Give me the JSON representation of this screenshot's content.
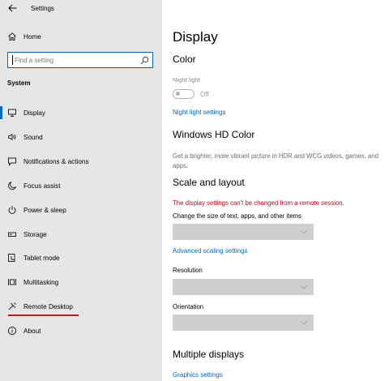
{
  "window": {
    "title": "Settings"
  },
  "sidebar": {
    "home_label": "Home",
    "search_placeholder": "Find a setting",
    "section_label": "System",
    "items": [
      {
        "label": "Display",
        "icon": "monitor-icon",
        "active": true
      },
      {
        "label": "Sound",
        "icon": "speaker-icon"
      },
      {
        "label": "Notifications & actions",
        "icon": "notifications-icon"
      },
      {
        "label": "Focus assist",
        "icon": "moon-icon"
      },
      {
        "label": "Power & sleep",
        "icon": "power-icon"
      },
      {
        "label": "Storage",
        "icon": "storage-icon"
      },
      {
        "label": "Tablet mode",
        "icon": "tablet-icon"
      },
      {
        "label": "Multitasking",
        "icon": "multitasking-icon"
      },
      {
        "label": "Remote Desktop",
        "icon": "remote-desktop-icon"
      },
      {
        "label": "About",
        "icon": "info-icon"
      }
    ]
  },
  "main": {
    "title": "Display",
    "color": {
      "heading": "Color",
      "night_light_label": "Night light",
      "toggle_state": "Off",
      "night_light_settings_link": "Night light settings"
    },
    "hd_color": {
      "heading": "Windows HD Color",
      "description": "Get a brighter, more vibrant picture in HDR and WCG videos, games, and apps."
    },
    "scale": {
      "heading": "Scale and layout",
      "warning": "The display settings can't be changed from a remote session.",
      "size_label": "Change the size of text, apps, and other items",
      "advanced_link": "Advanced scaling settings",
      "resolution_label": "Resolution",
      "orientation_label": "Orientation"
    },
    "multiple_displays": {
      "heading": "Multiple displays",
      "graphics_link": "Graphics settings"
    }
  },
  "colors": {
    "accent": "#0067b8",
    "warning": "#d0021b",
    "sidebar_bg": "#e6e6e6",
    "dropdown_disabled": "#cfcfcf"
  }
}
